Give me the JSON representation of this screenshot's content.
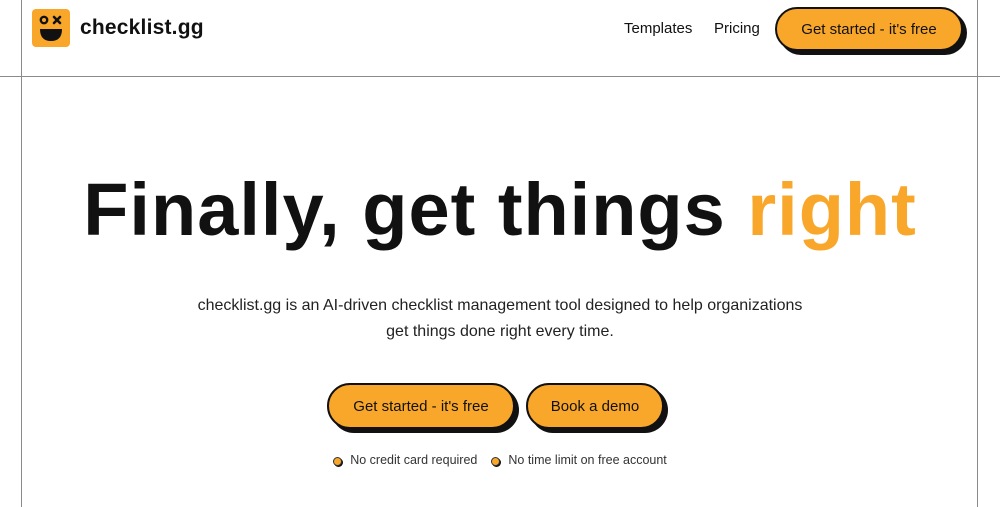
{
  "brand": {
    "name": "checklist.gg",
    "accent_color": "#f9a72b",
    "logo_icon": "smiley-face-icon"
  },
  "nav": {
    "templates": "Templates",
    "pricing": "Pricing",
    "cta": "Get started - it's free"
  },
  "hero": {
    "headline_main": "Finally, get things ",
    "headline_accent": "right",
    "subtitle_line1": "checklist.gg is an AI-driven checklist management tool designed to help organizations",
    "subtitle_line2": "get things done right every time.",
    "primary_button": "Get started - it's free",
    "demo_button": "Book a demo",
    "notes": [
      "No credit card required",
      "No time limit on free account"
    ]
  }
}
